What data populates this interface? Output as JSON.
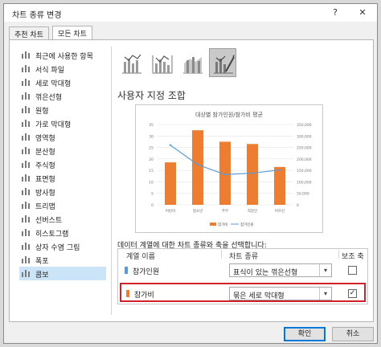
{
  "window": {
    "title": "차트 종류 변경",
    "help_glyph": "?",
    "close_glyph": "✕"
  },
  "tabs": [
    {
      "label": "추천 차트",
      "active": false
    },
    {
      "label": "모든 차트",
      "active": true
    }
  ],
  "sidebar": {
    "selected": "콤보",
    "items": [
      {
        "label": "최근에 사용한 항목",
        "icon": "recent-icon"
      },
      {
        "label": "서식 파일",
        "icon": "folder-icon"
      },
      {
        "label": "세로 막대형",
        "icon": "column-chart-icon"
      },
      {
        "label": "꺾은선형",
        "icon": "line-chart-icon"
      },
      {
        "label": "원형",
        "icon": "pie-chart-icon"
      },
      {
        "label": "가로 막대형",
        "icon": "bar-chart-icon"
      },
      {
        "label": "영역형",
        "icon": "area-chart-icon"
      },
      {
        "label": "분산형",
        "icon": "scatter-chart-icon"
      },
      {
        "label": "주식형",
        "icon": "stock-chart-icon"
      },
      {
        "label": "표면형",
        "icon": "surface-chart-icon"
      },
      {
        "label": "방사형",
        "icon": "radar-chart-icon"
      },
      {
        "label": "트리맵",
        "icon": "treemap-icon"
      },
      {
        "label": "선버스트",
        "icon": "sunburst-icon"
      },
      {
        "label": "히스토그램",
        "icon": "histogram-icon"
      },
      {
        "label": "상자 수염 그림",
        "icon": "box-whisker-icon"
      },
      {
        "label": "폭포",
        "icon": "waterfall-icon"
      },
      {
        "label": "콤보",
        "icon": "combo-chart-icon"
      }
    ]
  },
  "combo_types": [
    {
      "icon": "clustered-column-line-icon",
      "selected": false
    },
    {
      "icon": "clustered-column-line-secondary-icon",
      "selected": false
    },
    {
      "icon": "stacked-area-column-icon",
      "selected": false
    },
    {
      "icon": "custom-combo-icon",
      "selected": true
    }
  ],
  "section_title": "사용자 지정 조합",
  "chart_data": {
    "type": "bar",
    "title": "대상별 참가인원/참가비 평균",
    "categories": [
      "어린이",
      "청소년",
      "주부",
      "직장인",
      "어르신"
    ],
    "series": [
      {
        "name": "참가비",
        "type": "bar",
        "axis": "primary",
        "color": "#ed7d31",
        "values": [
          18.5,
          32.5,
          27.5,
          26.5,
          16.5
        ]
      },
      {
        "name": "참가인원",
        "type": "line",
        "axis": "secondary",
        "color": "#5b9bd5",
        "values": [
          260000,
          175000,
          132000,
          138000,
          152000
        ]
      }
    ],
    "y_ticks": [
      "0",
      "5",
      "10",
      "15",
      "20",
      "25",
      "30",
      "35"
    ],
    "ylim": [
      0,
      35
    ],
    "y2_ticks": [
      "0",
      "50,000",
      "100,000",
      "150,000",
      "200,000",
      "250,000",
      "300,000",
      "350,000"
    ],
    "y2lim": [
      0,
      350000
    ],
    "grid": true,
    "legend": "bottom"
  },
  "series_editor": {
    "caption": "데이터 계열에 대한 차트 종류와 축을 선택합니다:",
    "headers": {
      "name": "계열 이름",
      "type": "차트 종류",
      "axis": "보조 축"
    },
    "rows": [
      {
        "name": "참가인원",
        "chart_type": "표식이 있는 꺾은선형",
        "secondary_axis": false,
        "color": "#5b9bd5",
        "highlighted": false
      },
      {
        "name": "참가비",
        "chart_type": "묶은 세로 막대형",
        "secondary_axis": true,
        "color": "#ed7d31",
        "highlighted": true
      }
    ],
    "dropdown_glyph": "▾",
    "check_glyph": "✓"
  },
  "buttons": {
    "ok": "확인",
    "cancel": "취소"
  }
}
